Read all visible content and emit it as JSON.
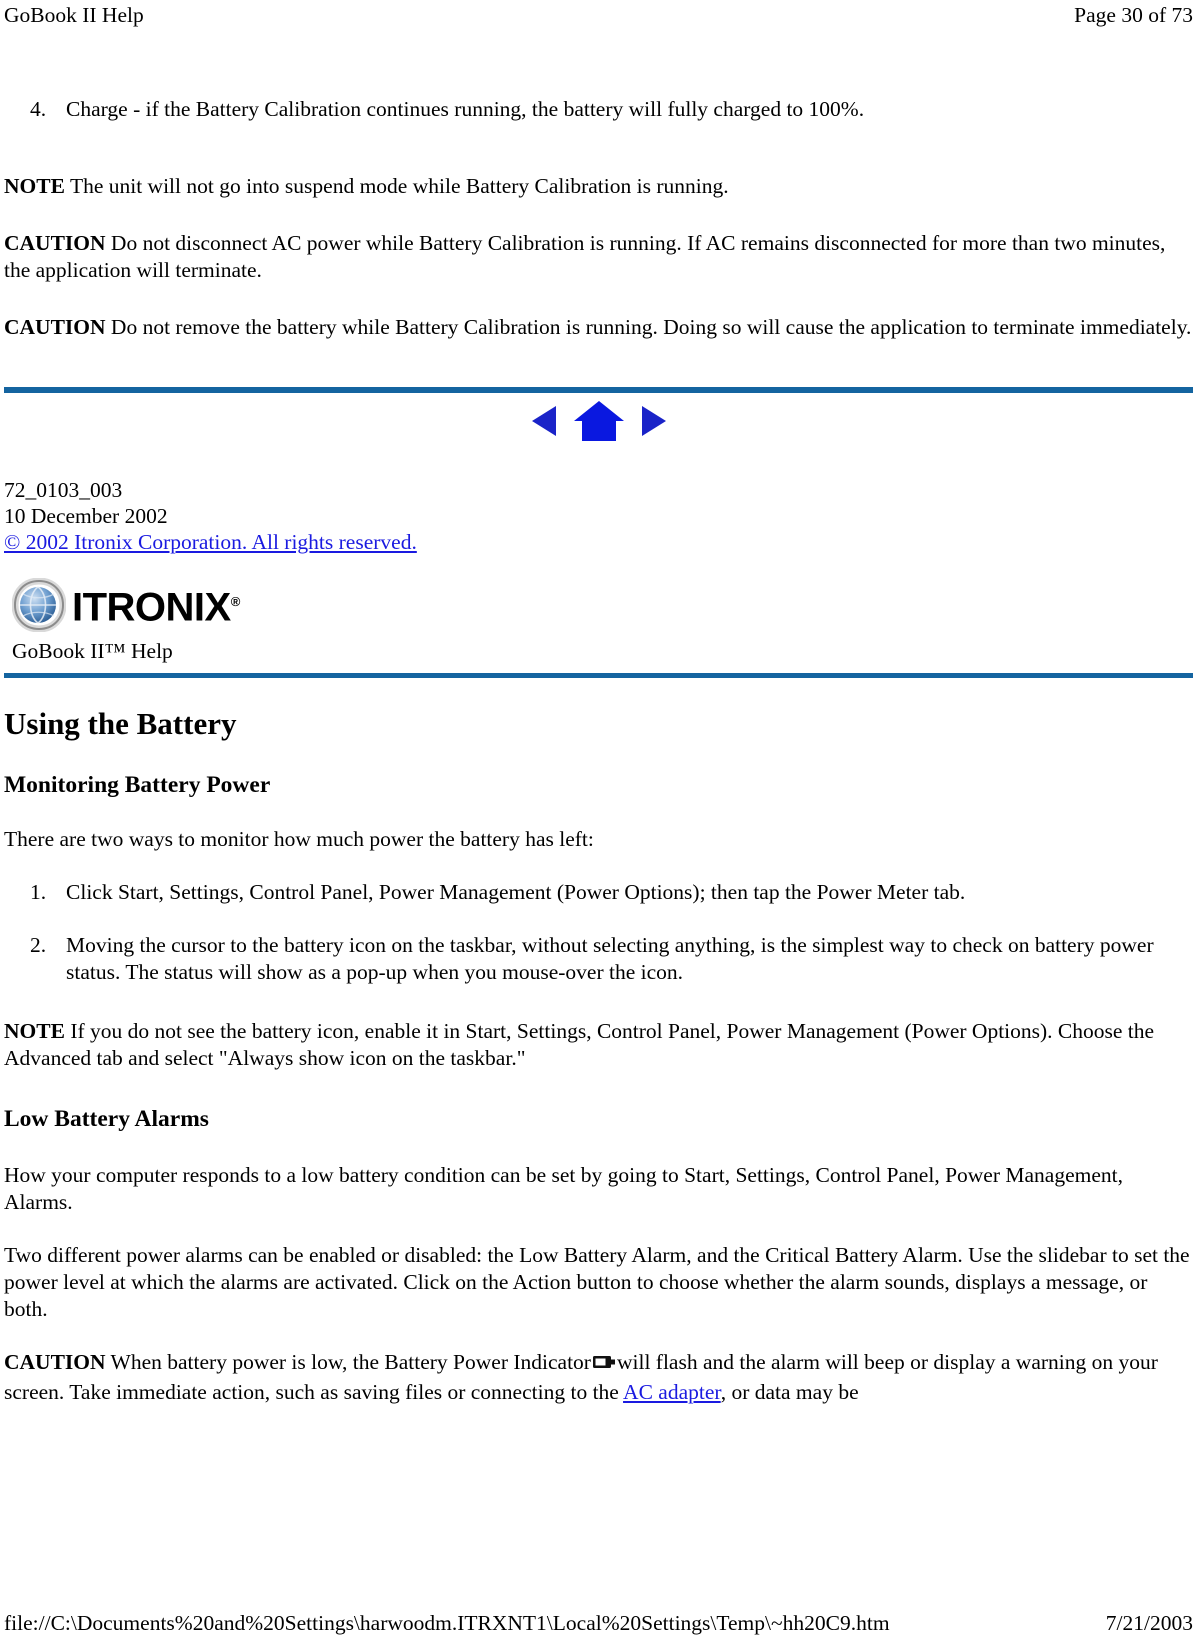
{
  "print_header": {
    "left": "GoBook II Help",
    "right": "Page 30 of 73"
  },
  "top_section": {
    "list_item_4_num": "4.",
    "list_item_4_text": "Charge - if the Battery Calibration continues running, the battery will fully charged to 100%.",
    "note_label": "NOTE",
    "note_text": "The unit will not go into suspend mode while Battery Calibration is running.",
    "caution1_label": "CAUTION",
    "caution1_text": "Do not disconnect AC power while Battery Calibration is running.  If AC remains disconnected for more than two minutes, the application will terminate.",
    "caution2_label": "CAUTION",
    "caution2_text": "Do not remove the battery while Battery Calibration is running. Doing so will cause the application to terminate immediately."
  },
  "nav": {
    "back_icon": "back-triangle-icon",
    "home_icon": "home-house-icon",
    "forward_icon": "forward-triangle-icon"
  },
  "doc_info": {
    "doc_number": "72_0103_003",
    "date": "10 December 2002",
    "copyright_link": "© 2002 Itronix Corporation.  All rights reserved."
  },
  "branding": {
    "logo_word": "ITRONIX",
    "logo_registered": "®",
    "logo_mark_icon": "itronix-globe-icon",
    "help_title": "GoBook II™ Help"
  },
  "main": {
    "h1": "Using the Battery",
    "h2_monitoring": "Monitoring Battery Power",
    "intro": "There are two ways to monitor how much power the battery has left:",
    "steps": [
      {
        "num": "1.",
        "text": "Click Start, Settings, Control Panel, Power Management (Power Options); then tap the Power Meter tab."
      },
      {
        "num": "2.",
        "text": "Moving the cursor to the battery icon on the taskbar, without selecting anything, is the simplest way to check on battery power status.  The status will show as a pop-up when you mouse-over the icon."
      }
    ],
    "note_label": "NOTE",
    "note_text": "If you do not see the battery icon, enable it in Start, Settings, Control Panel, Power Management (Power Options).  Choose the Advanced tab and select \"Always show icon on the taskbar.\"",
    "h2_alarms": "Low Battery Alarms",
    "alarms_p1": "How your computer responds to a low battery condition can be set by going to Start, Settings, Control Panel, Power Management, Alarms.",
    "alarms_p2": "Two different power alarms can be enabled or disabled: the Low Battery Alarm, and the Critical Battery Alarm.  Use the slidebar to set the power level at which the alarms are activated.  Click on the Action button to choose whether the alarm sounds, displays a message, or both.",
    "caution_label": "CAUTION",
    "caution_text_before_icon": "When battery power is low, the Battery Power Indicator",
    "battery_icon": "battery-indicator-icon",
    "caution_text_after_icon": "will flash and the alarm will beep or display a warning on your screen. Take immediate action, such as saving files or connecting to the",
    "ac_adapter_link": "AC adapter",
    "caution_text_tail": ", or data may be"
  },
  "print_footer": {
    "path": "file://C:\\Documents%20and%20Settings\\harwoodm.ITRXNT1\\Local%20Settings\\Temp\\~hh20C9.htm",
    "date": "7/21/2003"
  },
  "colors": {
    "rule_blue": "#1464a0",
    "link_blue": "#1a1ae0",
    "nav_blue": "#1a23c8"
  }
}
